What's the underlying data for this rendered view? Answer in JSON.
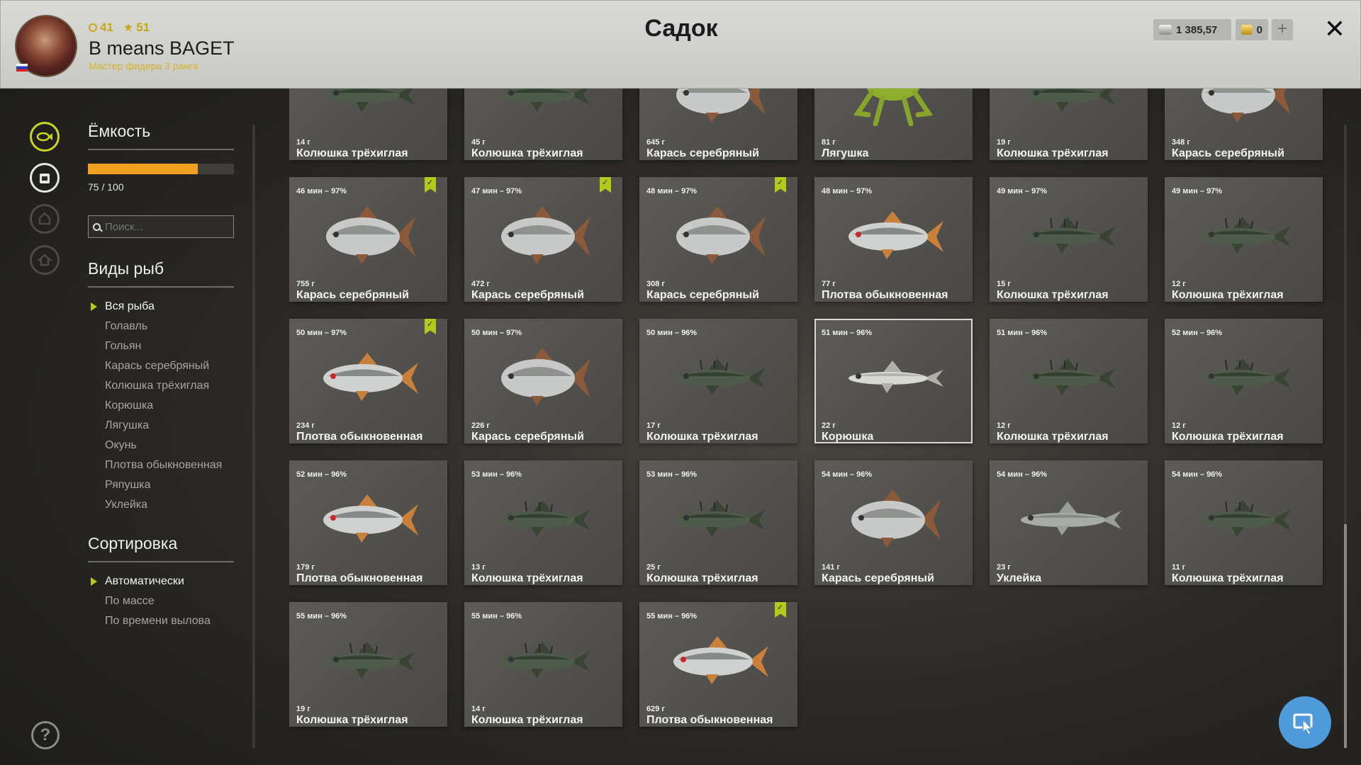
{
  "header": {
    "title": "Садок",
    "player_name": "B means BAGET",
    "player_rank": "Мастер фидера 3 ранга",
    "stat_level": "41",
    "stat_stars": "51",
    "silver": "1 385,57",
    "gold": "0",
    "plus_label": "+",
    "close_label": "✕"
  },
  "capacity": {
    "title": "Ёмкость",
    "value": 75,
    "max": 100,
    "text": "75 / 100"
  },
  "search": {
    "placeholder": "Поиск..."
  },
  "species_filter": {
    "title": "Виды рыб",
    "items": [
      "Вся рыба",
      "Голавль",
      "Гольян",
      "Карась серебряный",
      "Колюшка трёхиглая",
      "Корюшка",
      "Лягушка",
      "Окунь",
      "Плотва обыкновенная",
      "Ряпушка",
      "Уклейка"
    ],
    "selected": 0
  },
  "sorting": {
    "title": "Сортировка",
    "items": [
      "Автоматически",
      "По массе",
      "По времени вылова"
    ],
    "selected": 0
  },
  "help_label": "?",
  "colors": {
    "accent": "#b5c81c",
    "capacity": "#f0a020",
    "cursor_button": "#4f9ad8"
  },
  "catches": [
    {
      "time": "",
      "weight": "14 г",
      "species": "Колюшка трёхиглая",
      "kind": "stickleback",
      "bookmark": false
    },
    {
      "time": "",
      "weight": "45 г",
      "species": "Колюшка трёхиглая",
      "kind": "stickleback",
      "bookmark": false
    },
    {
      "time": "",
      "weight": "645 г",
      "species": "Карась серебряный",
      "kind": "carp",
      "bookmark": false
    },
    {
      "time": "",
      "weight": "81 г",
      "species": "Лягушка",
      "kind": "frog",
      "bookmark": false
    },
    {
      "time": "",
      "weight": "19 г",
      "species": "Колюшка трёхиглая",
      "kind": "stickleback",
      "bookmark": false
    },
    {
      "time": "",
      "weight": "348 г",
      "species": "Карась серебряный",
      "kind": "carp",
      "bookmark": false
    },
    {
      "time": "46 мин – 97%",
      "weight": "755 г",
      "species": "Карась серебряный",
      "kind": "carp",
      "bookmark": true
    },
    {
      "time": "47 мин – 97%",
      "weight": "472 г",
      "species": "Карась серебряный",
      "kind": "carp",
      "bookmark": true
    },
    {
      "time": "48 мин – 97%",
      "weight": "308 г",
      "species": "Карась серебряный",
      "kind": "carp",
      "bookmark": true
    },
    {
      "time": "48 мин – 97%",
      "weight": "77 г",
      "species": "Плотва обыкновенная",
      "kind": "roach",
      "bookmark": false
    },
    {
      "time": "49 мин – 97%",
      "weight": "15 г",
      "species": "Колюшка трёхиглая",
      "kind": "stickleback",
      "bookmark": false
    },
    {
      "time": "49 мин – 97%",
      "weight": "12 г",
      "species": "Колюшка трёхиглая",
      "kind": "stickleback",
      "bookmark": false
    },
    {
      "time": "50 мин – 97%",
      "weight": "234 г",
      "species": "Плотва обыкновенная",
      "kind": "roach",
      "bookmark": true
    },
    {
      "time": "50 мин – 97%",
      "weight": "226 г",
      "species": "Карась серебряный",
      "kind": "carp",
      "bookmark": false
    },
    {
      "time": "50 мин – 96%",
      "weight": "17 г",
      "species": "Колюшка трёхиглая",
      "kind": "stickleback",
      "bookmark": false
    },
    {
      "time": "51 мин – 96%",
      "weight": "22 г",
      "species": "Корюшка",
      "kind": "smelt",
      "bookmark": false,
      "selected": true
    },
    {
      "time": "51 мин – 96%",
      "weight": "12 г",
      "species": "Колюшка трёхиглая",
      "kind": "stickleback",
      "bookmark": false
    },
    {
      "time": "52 мин – 96%",
      "weight": "12 г",
      "species": "Колюшка трёхиглая",
      "kind": "stickleback",
      "bookmark": false
    },
    {
      "time": "52 мин – 96%",
      "weight": "179 г",
      "species": "Плотва обыкновенная",
      "kind": "roach",
      "bookmark": false
    },
    {
      "time": "53 мин – 96%",
      "weight": "13 г",
      "species": "Колюшка трёхиглая",
      "kind": "stickleback",
      "bookmark": false
    },
    {
      "time": "53 мин – 96%",
      "weight": "25 г",
      "species": "Колюшка трёхиглая",
      "kind": "stickleback",
      "bookmark": false
    },
    {
      "time": "54 мин – 96%",
      "weight": "141 г",
      "species": "Карась серебряный",
      "kind": "carp",
      "bookmark": false
    },
    {
      "time": "54 мин – 96%",
      "weight": "23 г",
      "species": "Уклейка",
      "kind": "bleak",
      "bookmark": false
    },
    {
      "time": "54 мин – 96%",
      "weight": "11 г",
      "species": "Колюшка трёхиглая",
      "kind": "stickleback",
      "bookmark": false
    },
    {
      "time": "55 мин – 96%",
      "weight": "19 г",
      "species": "Колюшка трёхиглая",
      "kind": "stickleback",
      "bookmark": false
    },
    {
      "time": "55 мин – 96%",
      "weight": "14 г",
      "species": "Колюшка трёхиглая",
      "kind": "stickleback",
      "bookmark": false
    },
    {
      "time": "55 мин – 96%",
      "weight": "629 г",
      "species": "Плотва обыкновенная",
      "kind": "roach",
      "bookmark": true
    }
  ]
}
